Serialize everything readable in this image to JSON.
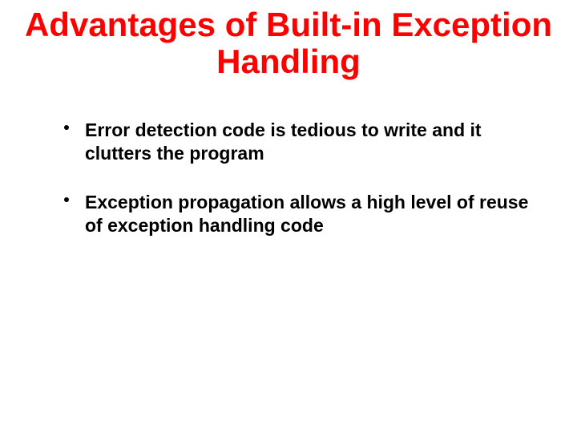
{
  "slide": {
    "title": "Advantages of Built-in Exception Handling",
    "bullets": [
      "Error detection code is tedious to write and it clutters the program",
      "Exception propagation allows a high level of reuse of exception handling code"
    ]
  }
}
